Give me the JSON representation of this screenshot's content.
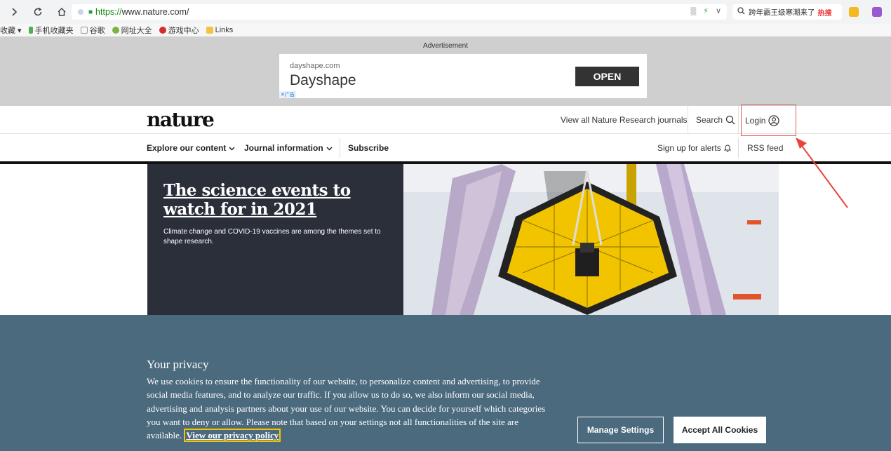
{
  "browser": {
    "url_protocol": "https://",
    "url_host": "www.nature.com/",
    "search_text": "跨年霸王级寒潮来了",
    "search_hot": "热搜"
  },
  "bookmarks": [
    {
      "label": "收藏",
      "icon": "star-icon"
    },
    {
      "label": "手机收藏夹",
      "icon": "phone-icon"
    },
    {
      "label": "谷歌",
      "icon": "page-icon"
    },
    {
      "label": "网址大全",
      "icon": "globe-icon"
    },
    {
      "label": "游戏中心",
      "icon": "game-icon"
    },
    {
      "label": "Links",
      "icon": "folder-icon"
    }
  ],
  "ad": {
    "label": "Advertisement",
    "domain": "dayshape.com",
    "title": "Dayshape",
    "button": "OPEN",
    "flag": "广告"
  },
  "header": {
    "logo": "nature",
    "view_all": "View all Nature Research journals",
    "search": "Search",
    "login": "Login"
  },
  "subnav": {
    "explore": "Explore our content",
    "journal": "Journal information",
    "subscribe": "Subscribe",
    "alerts": "Sign up for alerts",
    "rss": "RSS feed"
  },
  "hero": {
    "title": "The science events to watch for in 2021",
    "subtitle": "Climate change and COVID-19 vaccines are among the themes set to shape research."
  },
  "privacy": {
    "title": "Your privacy",
    "text": "We use cookies to ensure the functionality of our website, to personalize content and advertising, to provide social media features, and to analyze our traffic. If you allow us to do so, we also inform our social media, advertising and analysis partners about your use of our website. You can decide for yourself which categories you want to deny or allow. Please note that based on your settings not all functionalities of the site are available.",
    "link": "View our privacy policy",
    "manage": "Manage Settings",
    "accept": "Accept All Cookies"
  },
  "colors": {
    "accent_green": "#1a8a1a",
    "hero_bg": "#2a2f3a",
    "privacy_bg": "#4b6a7e",
    "annotation_red": "#e05a5a",
    "focus_yellow": "#f3c300"
  }
}
